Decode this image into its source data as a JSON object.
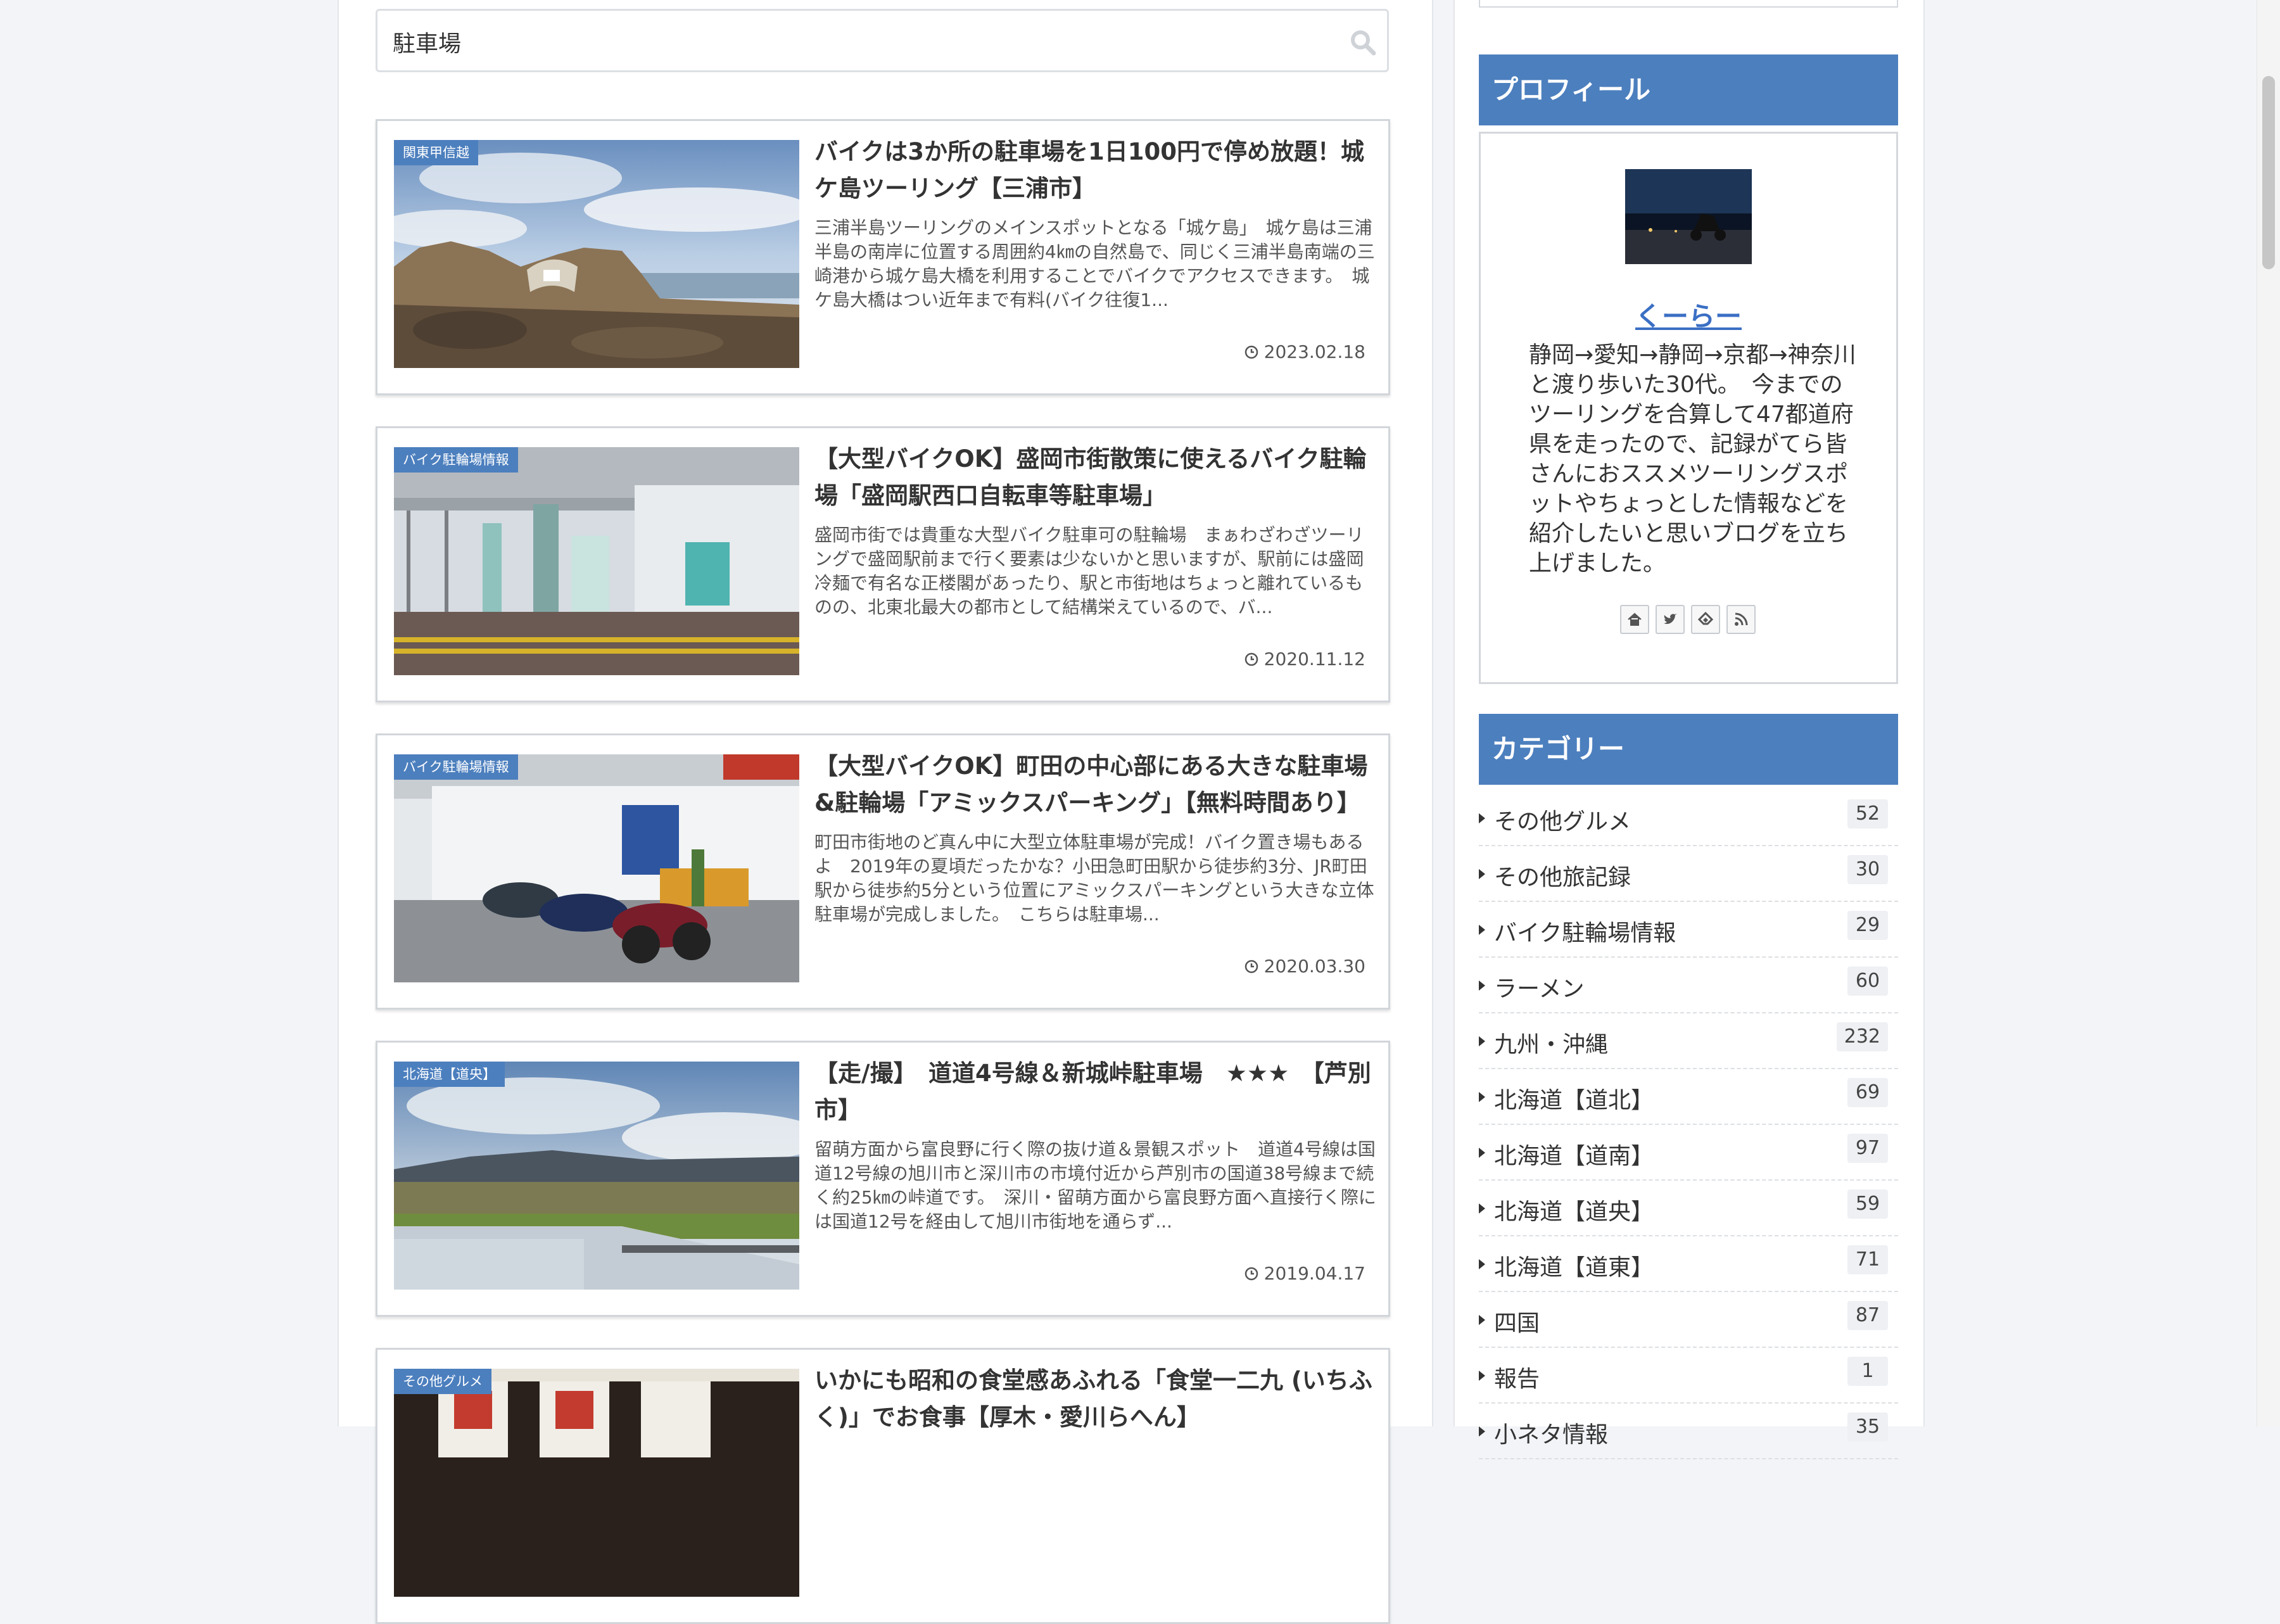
{
  "search": {
    "value": "駐車場",
    "placeholder": ""
  },
  "articles": [
    {
      "category": "関東甲信越",
      "title": "バイクは3か所の駐車場を1日100円で停め放題！城ケ島ツーリング【三浦市】",
      "excerpt": "三浦半島ツーリングのメインスポットとなる「城ケ島」　城ケ島は三浦半島の南岸に位置する周囲約4㎞の自然島で、同じく三浦半島南端の三崎港から城ケ島大橋を利用することでバイクでアクセスできます。　城ケ島大橋はつい近年まで有料(バイク往復1...",
      "date": "2023.02.18"
    },
    {
      "category": "バイク駐輪場情報",
      "title": "【大型バイクOK】盛岡市街散策に使えるバイク駐輪場「盛岡駅西口自転車等駐車場」",
      "excerpt": "盛岡市街では貴重な大型バイク駐車可の駐輪場　まぁわざわざツーリングで盛岡駅前まで行く要素は少ないかと思いますが、駅前には盛岡冷麺で有名な正楼閣があったり、駅と市街地はちょっと離れているものの、北東北最大の都市として結構栄えているので、バ...",
      "date": "2020.11.12"
    },
    {
      "category": "バイク駐輪場情報",
      "title": "【大型バイクOK】町田の中心部にある大きな駐車場&駐輪場「アミックスパーキング」【無料時間あり】",
      "excerpt": "町田市街地のど真ん中に大型立体駐車場が完成！バイク置き場もあるよ　2019年の夏頃だったかな？小田急町田駅から徒歩約3分、JR町田駅から徒歩約5分という位置にアミックスパーキングという大きな立体駐車場が完成しました。　こちらは駐車場...",
      "date": "2020.03.30"
    },
    {
      "category": "北海道【道央】",
      "title": "【走/撮】　道道4号線＆新城峠駐車場　★★★　【芦別市】",
      "excerpt": "留萌方面から富良野に行く際の抜け道＆景観スポット　道道4号線は国道12号線の旭川市と深川市の市境付近から芦別市の国道38号線まで続く約25㎞の峠道です。　深川・留萌方面から富良野方面へ直接行く際には国道12号を経由して旭川市街地を通らず...",
      "date": "2019.04.17"
    },
    {
      "category": "その他グルメ",
      "title": "いかにも昭和の食堂感あふれる「食堂一二九 (いちふく)」でお食事【厚木・愛川らへん】",
      "excerpt": "",
      "date": ""
    }
  ],
  "sidebar": {
    "profile_heading": "プロフィール",
    "profile_name": "くーらー",
    "profile_desc": "静岡→愛知→静岡→京都→神奈川と渡り歩いた30代。　今までのツーリングを合算して47都道府県を走ったので、記録がてら皆さんにおススメツーリングスポットやちょっとした情報などを紹介したいと思いブログを立ち上げました。",
    "social_icons": [
      "home-icon",
      "twitter-icon",
      "feedly-icon",
      "rss-icon"
    ],
    "category_heading": "カテゴリー",
    "categories": [
      {
        "label": "その他グルメ",
        "count": "52"
      },
      {
        "label": "その他旅記録",
        "count": "30"
      },
      {
        "label": "バイク駐輪場情報",
        "count": "29"
      },
      {
        "label": "ラーメン",
        "count": "60"
      },
      {
        "label": "九州・沖縄",
        "count": "232"
      },
      {
        "label": "北海道【道北】",
        "count": "69"
      },
      {
        "label": "北海道【道南】",
        "count": "97"
      },
      {
        "label": "北海道【道央】",
        "count": "59"
      },
      {
        "label": "北海道【道東】",
        "count": "71"
      },
      {
        "label": "四国",
        "count": "87"
      },
      {
        "label": "報告",
        "count": "1"
      },
      {
        "label": "小ネタ情報",
        "count": "35"
      }
    ]
  },
  "colors": {
    "accent": "#4c7fbe",
    "link": "#3b6fc4"
  }
}
